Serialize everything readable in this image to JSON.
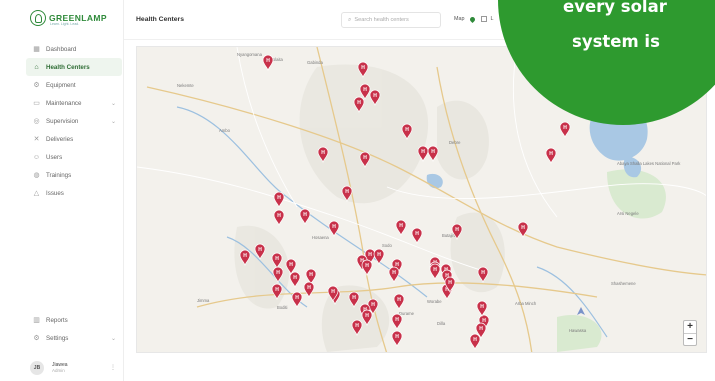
{
  "brand": {
    "name": "GREENLAMP",
    "tagline": "Learn. Light. Lead."
  },
  "sidebar": {
    "items": [
      {
        "label": "Dashboard",
        "icon": "grid-icon"
      },
      {
        "label": "Health Centers",
        "icon": "home-icon",
        "active": true
      },
      {
        "label": "Equipment",
        "icon": "equipment-icon"
      },
      {
        "label": "Maintenance",
        "icon": "maintenance-icon",
        "expandable": true
      },
      {
        "label": "Supervision",
        "icon": "supervision-icon",
        "expandable": true
      },
      {
        "label": "Deliveries",
        "icon": "deliveries-icon"
      },
      {
        "label": "Users",
        "icon": "users-icon"
      },
      {
        "label": "Trainings",
        "icon": "trainings-icon"
      },
      {
        "label": "Issues",
        "icon": "warning-icon"
      }
    ],
    "bottom_items": [
      {
        "label": "Reports",
        "icon": "reports-icon"
      },
      {
        "label": "Settings",
        "icon": "settings-icon",
        "expandable": true
      }
    ],
    "user": {
      "initials": "JB",
      "name": "Jiawea",
      "role": "Admin"
    }
  },
  "header": {
    "title": "Health Centers",
    "search_placeholder": "Search health centers",
    "view_label": "Map",
    "list_label": "L"
  },
  "map": {
    "place_labels": [
      "Nyangomana",
      "Wolaita",
      "Gabinda",
      "Kalafo",
      "Abaya",
      "Bahir",
      "Debre",
      "Ambo",
      "Abaya Shalla Lakes National Park",
      "Nekemte",
      "Jimma",
      "Hawassa",
      "Shashemene",
      "Sodo",
      "Boditi",
      "Durame",
      "Dilla",
      "Arsi Negele",
      "Hosaena",
      "Butajira",
      "Worabe",
      "Arba Minch"
    ],
    "marker_letter": "H",
    "marker_color": "#c8314a",
    "zoom_in": "+",
    "zoom_out": "−"
  },
  "promo": {
    "lines": [
      "every solar",
      "system is"
    ],
    "color": "#2e9a2f"
  }
}
